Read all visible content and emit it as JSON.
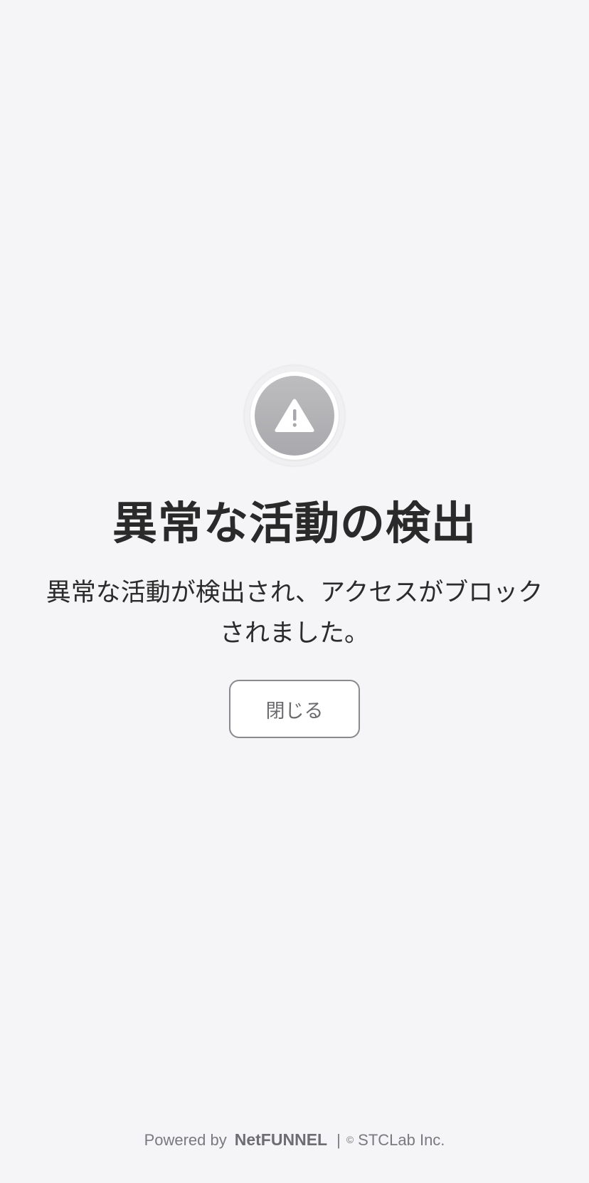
{
  "dialog": {
    "title": "異常な活動の検出",
    "message_line1": "異常な活動が検出され、アクセスがブロック",
    "message_line2": "されました。",
    "close_label": "閉じる",
    "icon": "warning-icon"
  },
  "footer": {
    "powered_by": "Powered by",
    "brand": "NetFUNNEL",
    "separator": "|",
    "copyright_symbol": "©",
    "company": "STCLab Inc."
  },
  "colors": {
    "background": "#f5f5f7",
    "icon_circle": "#b3b3b6",
    "title_text": "#2a2a2a",
    "button_border": "#8a8a8e",
    "footer_text": "#7a7a7e"
  }
}
